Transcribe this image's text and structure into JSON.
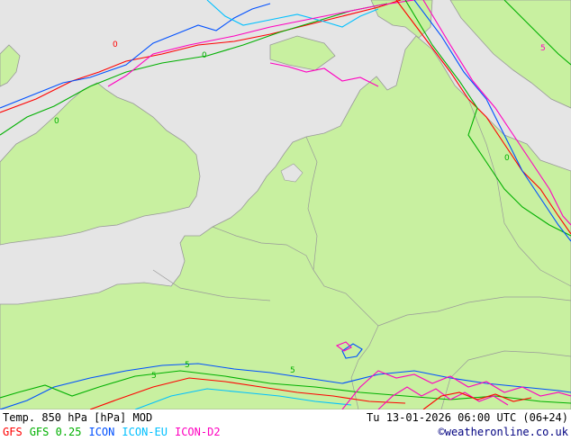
{
  "header": {
    "product": "Temp. 850 hPa [hPa] MOD",
    "valid_time": "Tu 13-01-2026 06:00 UTC (06+24)"
  },
  "legend": {
    "models": [
      {
        "label": "GFS",
        "color": "#ff0000"
      },
      {
        "label": "GFS 0.25",
        "color": "#00b000"
      },
      {
        "label": "ICON",
        "color": "#0050ff"
      },
      {
        "label": "ICON-EU",
        "color": "#00c0ff"
      },
      {
        "label": "ICON-D2",
        "color": "#ff00c0"
      }
    ],
    "credit": "©weatheronline.co.uk",
    "credit_color": "#000080"
  },
  "map": {
    "land_color": "#c8f0a0",
    "sea_color": "#e5e5e5",
    "border_color": "#999999",
    "contour_labels": [
      "0",
      "0",
      "0",
      "0",
      "5",
      "5",
      "5",
      "5"
    ]
  }
}
